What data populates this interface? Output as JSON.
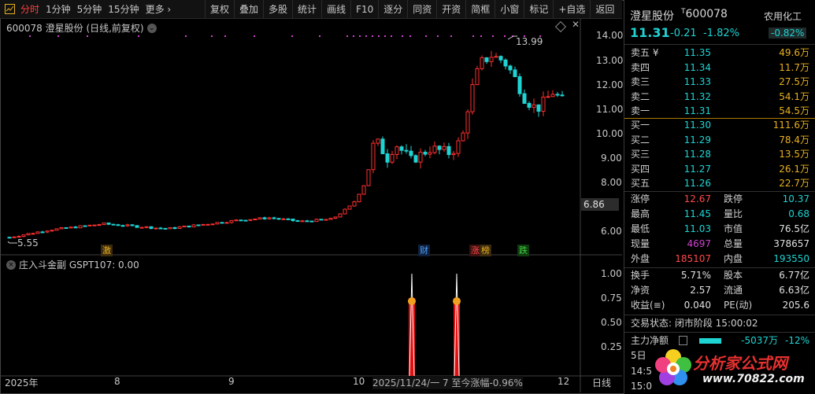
{
  "toolbar": {
    "left_items": [
      "分时",
      "1分钟",
      "5分钟",
      "15分钟",
      "更多 ›"
    ],
    "right_items": [
      "复权",
      "叠加",
      "多股",
      "统计",
      "画线",
      "F10",
      "逐分",
      "同资",
      "开资",
      "简框",
      "小窗",
      "标记",
      "+自选",
      "返回"
    ]
  },
  "chart": {
    "title": "600078  澄星股份 (日线,前复权)",
    "price_axis": [
      "14.00",
      "13.00",
      "12.00",
      "11.00",
      "10.00",
      "9.00",
      "8.00",
      "6.00"
    ],
    "cursor_value": "6.86",
    "high_label": "13.99",
    "low_label": "5.55",
    "event_tags": [
      {
        "text": "激",
        "color": "#e8b020"
      },
      {
        "text": "财",
        "color": "#4aa0ff"
      },
      {
        "text": "涨",
        "color": "#ff4848"
      },
      {
        "text": "榜",
        "color": "#e8b020"
      },
      {
        "text": "跌",
        "color": "#40d040"
      }
    ]
  },
  "indicator": {
    "title": "庄入斗金副  GSPT107: 0.00",
    "axis": [
      "1.00",
      "0.75",
      "0.50",
      "0.25"
    ]
  },
  "dates": [
    "2025年",
    "8",
    "9",
    "10",
    "12"
  ],
  "status_line": "2025/11/24/一  7 至今涨幅-0.96%",
  "period_label": "日线",
  "stock": {
    "name": "澄星股份",
    "code": "600078",
    "price": "11.31",
    "change": "-0.21",
    "change_pct": "-1.82%",
    "sector": "农用化工",
    "sector_pct": "-0.82%"
  },
  "asks": [
    {
      "label": "卖五 ¥",
      "price": "11.35",
      "vol": "49.6万"
    },
    {
      "label": "卖四",
      "price": "11.34",
      "vol": "11.7万"
    },
    {
      "label": "卖三",
      "price": "11.33",
      "vol": "27.5万"
    },
    {
      "label": "卖二",
      "price": "11.32",
      "vol": "54.1万"
    },
    {
      "label": "卖一",
      "price": "11.31",
      "vol": "54.5万"
    }
  ],
  "bids": [
    {
      "label": "买一",
      "price": "11.30",
      "vol": "111.6万"
    },
    {
      "label": "买二",
      "price": "11.29",
      "vol": "78.4万"
    },
    {
      "label": "买三",
      "price": "11.28",
      "vol": "13.5万"
    },
    {
      "label": "买四",
      "price": "11.27",
      "vol": "26.1万"
    },
    {
      "label": "买五",
      "price": "11.26",
      "vol": "22.7万"
    }
  ],
  "stats1": [
    {
      "l1": "涨停",
      "v1": "12.67",
      "c1": "red",
      "l2": "跌停",
      "v2": "10.37",
      "c2": "cyan"
    },
    {
      "l1": "最高",
      "v1": "11.45",
      "c1": "cyan",
      "l2": "量比",
      "v2": "0.68",
      "c2": "cyan"
    },
    {
      "l1": "最低",
      "v1": "11.03",
      "c1": "cyan",
      "l2": "市值",
      "v2": "76.5亿",
      "c2": "white"
    },
    {
      "l1": "现量",
      "v1": "4697",
      "c1": "purple",
      "l2": "总量",
      "v2": "378657",
      "c2": "white"
    },
    {
      "l1": "外盘",
      "v1": "185107",
      "c1": "red",
      "l2": "内盘",
      "v2": "193550",
      "c2": "cyan"
    }
  ],
  "stats2": [
    {
      "l1": "换手",
      "v1": "5.71%",
      "l2": "股本",
      "v2": "6.77亿"
    },
    {
      "l1": "净资",
      "v1": "2.57",
      "l2": "流通",
      "v2": "6.63亿"
    },
    {
      "l1": "收益(≡)",
      "v1": "0.040",
      "l2": "PE(动)",
      "v2": "205.6"
    }
  ],
  "trade_status": "交易状态: 闭市阶段 15:00:02",
  "main_flow": {
    "label": "主力净额",
    "value": "-5037万",
    "pct": "-12%"
  },
  "time_rows": [
    "5日",
    "14:5",
    "15:0"
  ],
  "logo": {
    "text": "分析家公式网",
    "url": "www.70822.com"
  }
}
